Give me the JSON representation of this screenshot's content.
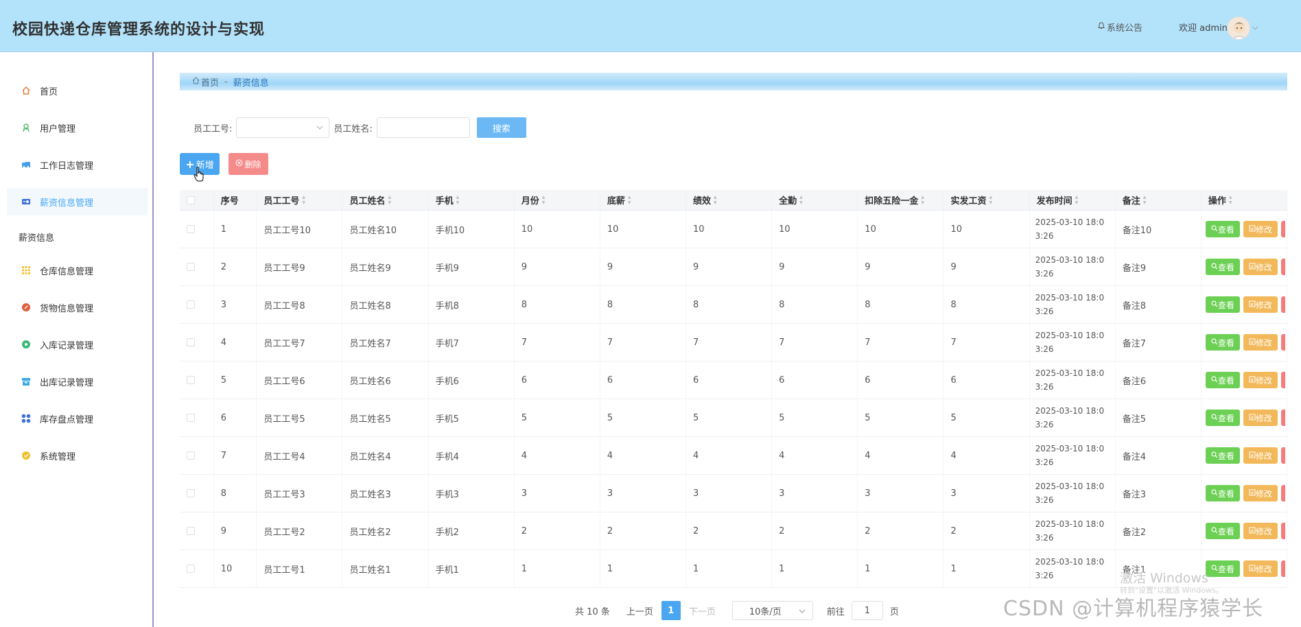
{
  "header": {
    "title": "校园快递仓库管理系统的设计与实现",
    "notice": "系统公告",
    "welcome": "欢迎 admin"
  },
  "sidebar": {
    "items": [
      {
        "label": "首页",
        "icon": "home-icon",
        "color": "#e07a3a"
      },
      {
        "label": "用户管理",
        "icon": "user-icon",
        "color": "#4bbf6b"
      },
      {
        "label": "工作日志管理",
        "icon": "folder-icon",
        "color": "#4a9fe8"
      },
      {
        "label": "薪资信息管理",
        "icon": "card-icon",
        "color": "#3d72d9"
      }
    ],
    "group_label": "薪资信息",
    "items2": [
      {
        "label": "仓库信息管理",
        "icon": "grid-icon",
        "color": "#f3c33b"
      },
      {
        "label": "货物信息管理",
        "icon": "box-icon",
        "color": "#e0603f"
      },
      {
        "label": "入库记录管理",
        "icon": "in-icon",
        "color": "#3cb878"
      },
      {
        "label": "出库记录管理",
        "icon": "out-icon",
        "color": "#3ba8e0"
      },
      {
        "label": "库存盘点管理",
        "icon": "apps-icon",
        "color": "#3f6fd6"
      },
      {
        "label": "系统管理",
        "icon": "setting-icon",
        "color": "#f0c12e"
      }
    ]
  },
  "breadcrumb": {
    "home": "首页",
    "sep": "-",
    "current": "薪资信息"
  },
  "search": {
    "label1": "员工工号:",
    "label2": "员工姓名:",
    "button": "搜索"
  },
  "actions": {
    "add": "新增",
    "delete": "删除"
  },
  "table": {
    "columns": [
      "序号",
      "员工工号",
      "员工姓名",
      "手机",
      "月份",
      "底薪",
      "绩效",
      "全勤",
      "扣除五险一金",
      "实发工资",
      "发布时间",
      "备注",
      "操作"
    ],
    "rows": [
      [
        "1",
        "员工工号10",
        "员工姓名10",
        "手机10",
        "10",
        "10",
        "10",
        "10",
        "10",
        "10",
        "2025-03-10 18:03:26",
        "备注10"
      ],
      [
        "2",
        "员工工号9",
        "员工姓名9",
        "手机9",
        "9",
        "9",
        "9",
        "9",
        "9",
        "9",
        "2025-03-10 18:03:26",
        "备注9"
      ],
      [
        "3",
        "员工工号8",
        "员工姓名8",
        "手机8",
        "8",
        "8",
        "8",
        "8",
        "8",
        "8",
        "2025-03-10 18:03:26",
        "备注8"
      ],
      [
        "4",
        "员工工号7",
        "员工姓名7",
        "手机7",
        "7",
        "7",
        "7",
        "7",
        "7",
        "7",
        "2025-03-10 18:03:26",
        "备注7"
      ],
      [
        "5",
        "员工工号6",
        "员工姓名6",
        "手机6",
        "6",
        "6",
        "6",
        "6",
        "6",
        "6",
        "2025-03-10 18:03:26",
        "备注6"
      ],
      [
        "6",
        "员工工号5",
        "员工姓名5",
        "手机5",
        "5",
        "5",
        "5",
        "5",
        "5",
        "5",
        "2025-03-10 18:03:26",
        "备注5"
      ],
      [
        "7",
        "员工工号4",
        "员工姓名4",
        "手机4",
        "4",
        "4",
        "4",
        "4",
        "4",
        "4",
        "2025-03-10 18:03:26",
        "备注4"
      ],
      [
        "8",
        "员工工号3",
        "员工姓名3",
        "手机3",
        "3",
        "3",
        "3",
        "3",
        "3",
        "3",
        "2025-03-10 18:03:26",
        "备注3"
      ],
      [
        "9",
        "员工工号2",
        "员工姓名2",
        "手机2",
        "2",
        "2",
        "2",
        "2",
        "2",
        "2",
        "2025-03-10 18:03:26",
        "备注2"
      ],
      [
        "10",
        "员工工号1",
        "员工姓名1",
        "手机1",
        "1",
        "1",
        "1",
        "1",
        "1",
        "1",
        "2025-03-10 18:03:26",
        "备注1"
      ]
    ],
    "view_label": "查看",
    "edit_label": "修改"
  },
  "pagination": {
    "total": "共 10 条",
    "prev": "上一页",
    "current": "1",
    "next": "下一页",
    "page_size": "10条/页",
    "goto": "前往",
    "goto_value": "1",
    "page_unit": "页"
  },
  "watermark": {
    "activate": "激活 Windows",
    "activate_sub": "转到\"设置\"以激活 Windows。",
    "csdn": "CSDN @计算机程序猿学长"
  },
  "colors": {
    "header_bg": "#b3e2fb",
    "primary": "#4aa6f0",
    "danger": "#f48a8a",
    "success": "#6cd054",
    "warning": "#f2b85a"
  }
}
